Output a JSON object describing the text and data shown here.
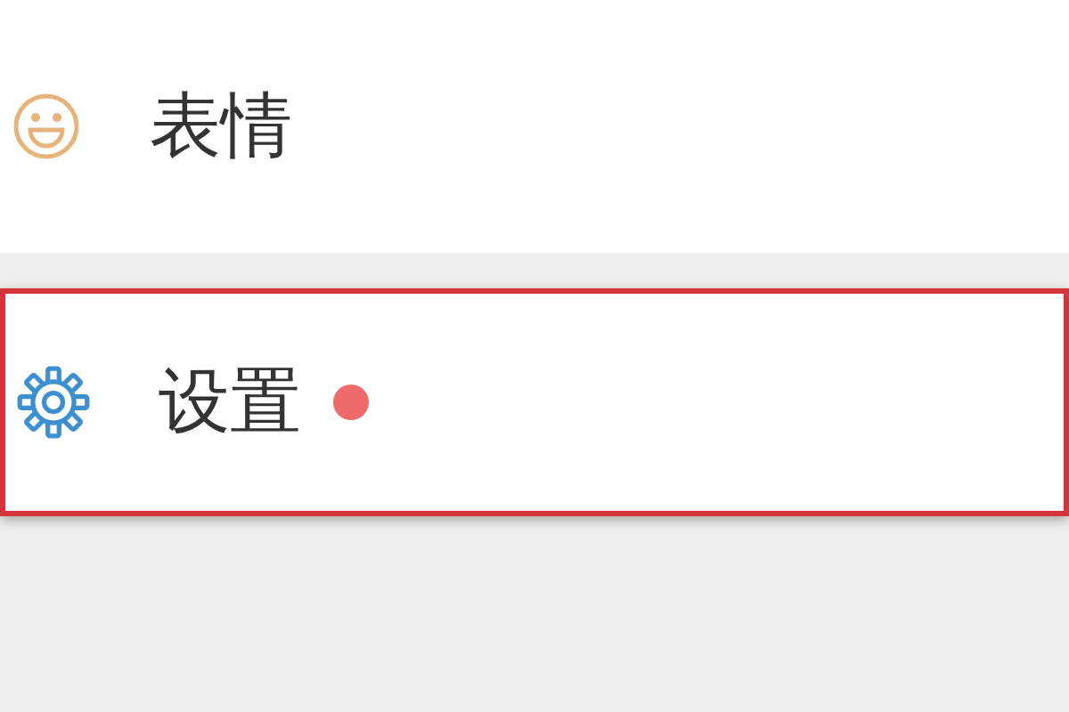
{
  "menu_items": [
    {
      "label": "表情",
      "kind": "emoji",
      "highlighted": false,
      "has_dot": false
    },
    {
      "label": "设置",
      "kind": "settings",
      "highlighted": true,
      "has_dot": true
    }
  ]
}
